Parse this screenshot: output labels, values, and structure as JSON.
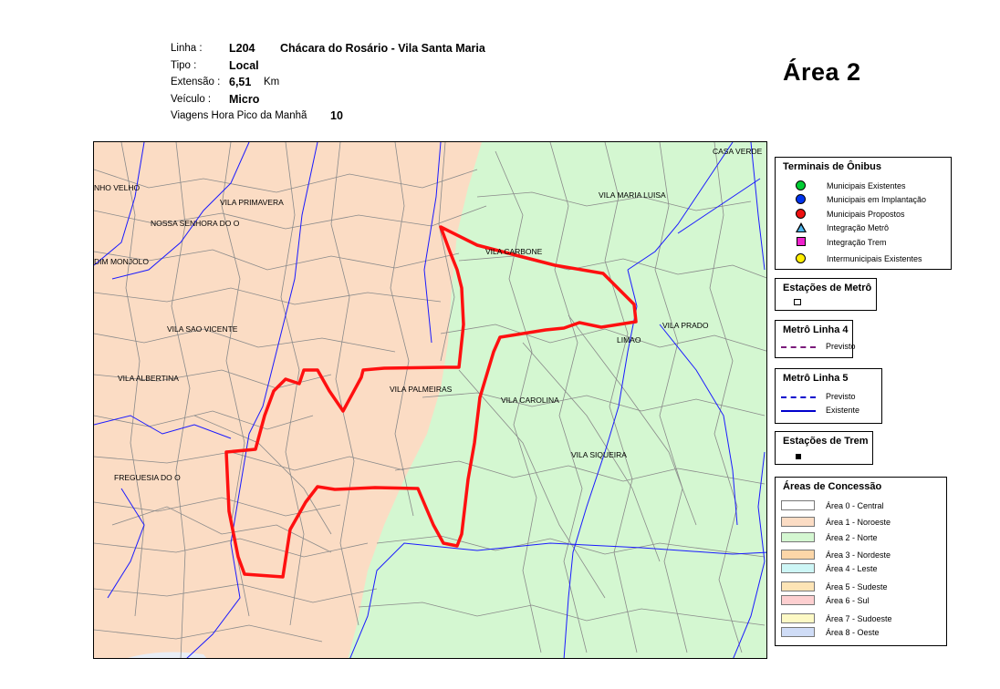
{
  "header": {
    "linha_label": "Linha :",
    "linha_code": "L204",
    "linha_name": "Chácara do Rosário - Vila Santa Maria",
    "tipo_label": "Tipo :",
    "tipo_value": "Local",
    "extensao_label": "Extensão :",
    "extensao_value": "6,51",
    "extensao_unit": "Km",
    "veiculo_label": "Veículo :",
    "veiculo_value": "Micro",
    "viagens_label": "Viagens Hora Pico da Manhã",
    "viagens_value": "10"
  },
  "area_title": "Área  2",
  "map_labels": [
    {
      "text": "NHO VELHO"
    },
    {
      "text": "VILA PRIMAVERA"
    },
    {
      "text": "NOSSA SENHORA DO O"
    },
    {
      "text": "DIM MONJOLO"
    },
    {
      "text": "VILA SAO VICENTE"
    },
    {
      "text": "VILA ALBERTINA"
    },
    {
      "text": "FREGUESIA DO O"
    },
    {
      "text": "VILA PALMEIRAS"
    },
    {
      "text": "VILA CARBONE"
    },
    {
      "text": "VILA CAROLINA"
    },
    {
      "text": "VILA SIQUEIRA"
    },
    {
      "text": "VILA MARIA LUISA"
    },
    {
      "text": "VILA PRADO"
    },
    {
      "text": "LIMAO"
    },
    {
      "text": "CASA VERDE"
    }
  ],
  "legend": {
    "terminais": {
      "title": "Terminais de Ônibus",
      "items": [
        {
          "label": "Municipais Existentes",
          "symbol": "circle",
          "color": "#00cc33"
        },
        {
          "label": "Municipais em Implantação",
          "symbol": "circle",
          "color": "#0033ee"
        },
        {
          "label": "Municipais Propostos",
          "symbol": "circle",
          "color": "#ee1111"
        },
        {
          "label": "Integração Metrô",
          "symbol": "triangle",
          "color": "#4fb8f0"
        },
        {
          "label": "Integração Trem",
          "symbol": "square",
          "color": "#ee22cc"
        },
        {
          "label": "Intermunicipais Existentes",
          "symbol": "circle",
          "color": "#ffee00"
        }
      ]
    },
    "estacoes_metro": {
      "title": "Estações de Metrô"
    },
    "metro_linha4": {
      "title": "Metrô Linha 4",
      "items": [
        {
          "label": "Previsto",
          "color": "#7a1a7a",
          "style": "dashed"
        }
      ]
    },
    "metro_linha5": {
      "title": "Metrô Linha 5",
      "items": [
        {
          "label": "Previsto",
          "color": "#0000cc",
          "style": "dashed"
        },
        {
          "label": "Existente",
          "color": "#0000cc",
          "style": "solid"
        }
      ]
    },
    "estacoes_trem": {
      "title": "Estações de Trem"
    },
    "areas": {
      "title": "Áreas de Concessão",
      "items": [
        {
          "label": "Área 0 - Central",
          "color": "#ffffff"
        },
        {
          "label": "Área 1 - Noroeste",
          "color": "#fbdcc4"
        },
        {
          "label": "Área 2 - Norte",
          "color": "#d4f7d1"
        },
        {
          "label": "Área 3 - Nordeste",
          "color": "#fcd6a8"
        },
        {
          "label": "Área 4 - Leste",
          "color": "#cdf6f6"
        },
        {
          "label": "Área 5 - Sudeste",
          "color": "#fde4b5"
        },
        {
          "label": "Área 6 - Sul",
          "color": "#fdcfd0"
        },
        {
          "label": "Área 7 - Sudoeste",
          "color": "#fdf9c5"
        },
        {
          "label": "Área 8 - Oeste",
          "color": "#cfdcf6"
        }
      ]
    }
  },
  "colors": {
    "area1_fill": "#fbdcc4",
    "area2_fill": "#d4f7d1",
    "street": "#8a8a8a",
    "river": "#1a1aff",
    "route": "#ff1010"
  }
}
